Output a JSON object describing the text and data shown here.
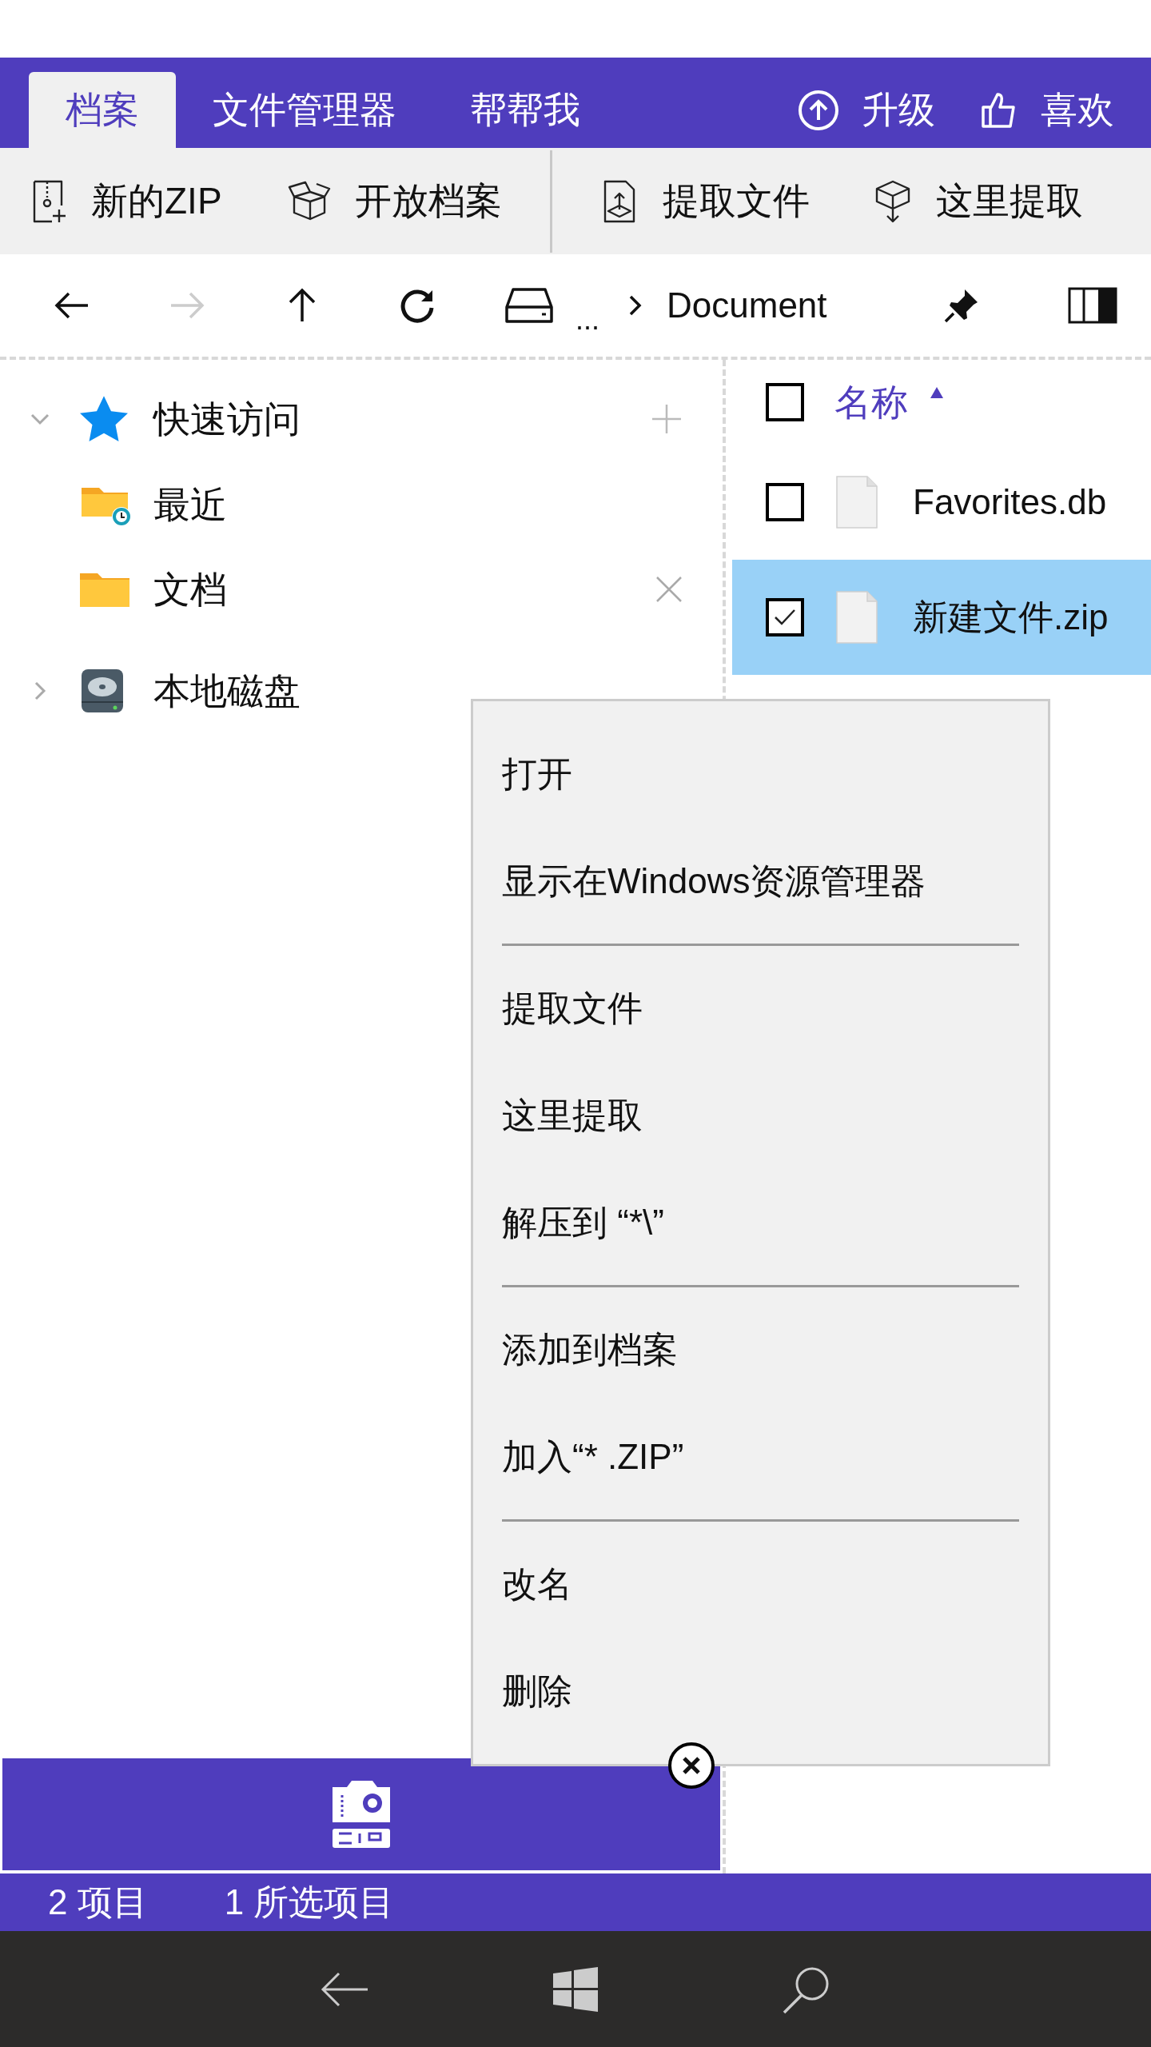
{
  "tabs": [
    {
      "label": "档案",
      "selected": true
    },
    {
      "label": "文件管理器",
      "selected": false
    },
    {
      "label": "帮帮我",
      "selected": false
    }
  ],
  "tab_actions": [
    {
      "kind": "upgrade",
      "label": "升级"
    },
    {
      "kind": "like",
      "label": "喜欢"
    }
  ],
  "toolbar": [
    {
      "kind": "new-zip",
      "label": "新的ZIP"
    },
    {
      "kind": "open",
      "label": "开放档案"
    },
    {
      "kind": "extract",
      "label": "提取文件"
    },
    {
      "kind": "extract-here",
      "label": "这里提取"
    }
  ],
  "nav": {
    "back_disabled": false,
    "forward_disabled": true,
    "breadcrumb_ellipsis": "...",
    "path": "Document"
  },
  "tree": [
    {
      "label": "快速访问",
      "kind": "star",
      "expanded": true,
      "add_button": true,
      "children": [
        {
          "label": "最近",
          "kind": "folder-clock"
        },
        {
          "label": "文档",
          "kind": "folder",
          "close_button": true
        }
      ]
    },
    {
      "label": "本地磁盘",
      "kind": "drive",
      "expanded": false
    }
  ],
  "file_list": {
    "header": {
      "label": "名称",
      "checked": false,
      "sort_ascending": true
    },
    "rows": [
      {
        "name": "Favorites.db",
        "checked": false,
        "selected": false
      },
      {
        "name": "新建文件.zip",
        "checked": true,
        "selected": true
      }
    ]
  },
  "context_menu": [
    {
      "kind": "item",
      "label": "打开"
    },
    {
      "kind": "item",
      "label": "显示在Windows资源管理器"
    },
    {
      "kind": "divider"
    },
    {
      "kind": "item",
      "label": "提取文件"
    },
    {
      "kind": "item",
      "label": "这里提取"
    },
    {
      "kind": "item",
      "label": "解压到 “*\\”"
    },
    {
      "kind": "divider"
    },
    {
      "kind": "item",
      "label": "添加到档案"
    },
    {
      "kind": "item",
      "label": "加入“* .ZIP”"
    },
    {
      "kind": "divider"
    },
    {
      "kind": "item",
      "label": "改名"
    },
    {
      "kind": "item",
      "label": "删除"
    }
  ],
  "status_bar": [
    "2 项目",
    "1 所选项目"
  ]
}
